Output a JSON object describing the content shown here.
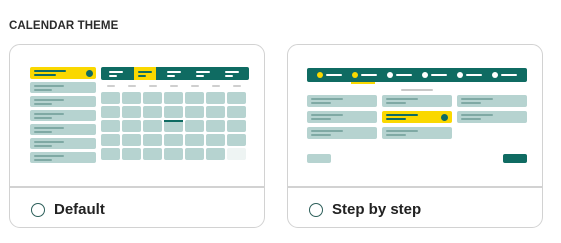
{
  "section": {
    "title": "CALENDAR THEME"
  },
  "options": [
    {
      "label": "Default",
      "selected": false
    },
    {
      "label": "Step by step",
      "selected": false
    }
  ],
  "colors": {
    "teal": "#0f6b62",
    "yellow": "#fad800",
    "light_teal": "#b6d3d0",
    "border": "#d2d2d2"
  },
  "icons": [
    "radio-unchecked-icon",
    "check-circle-icon"
  ]
}
